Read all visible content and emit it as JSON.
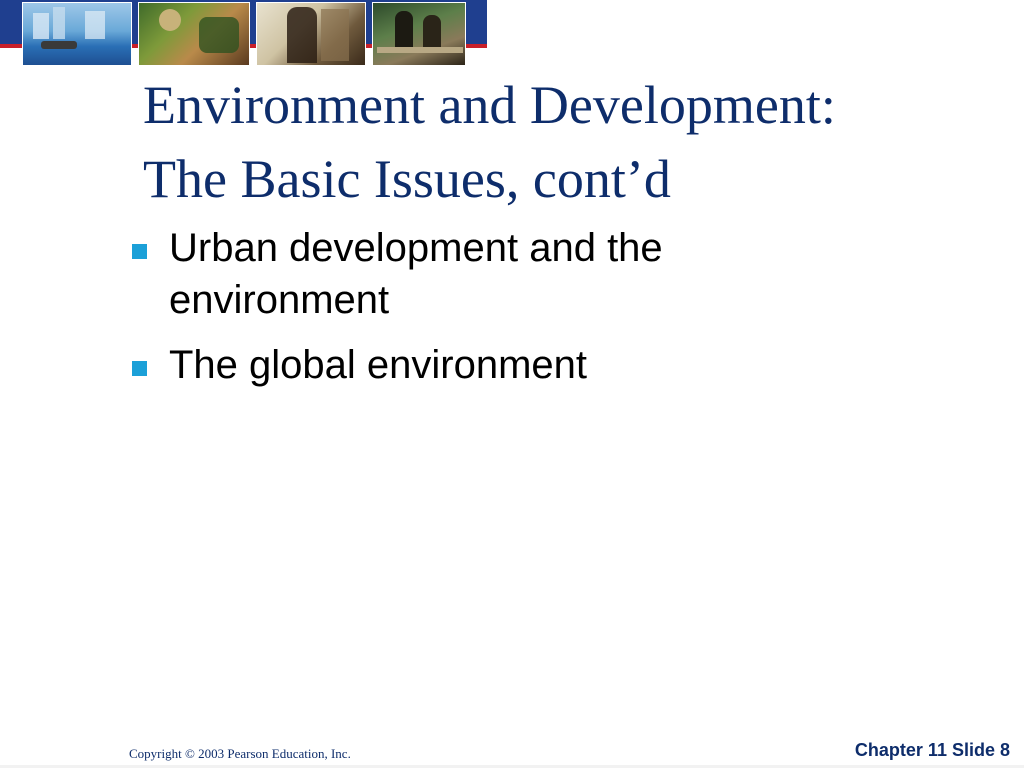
{
  "slide": {
    "title_lines": [
      "Environment and Development:",
      "The Basic Issues, cont’d"
    ],
    "bullets": [
      {
        "lines": [
          "Urban development and the",
          "environment"
        ]
      },
      {
        "lines": [
          "The global environment"
        ]
      }
    ],
    "footer": {
      "copyright": "Copyright © 2003 Pearson Education, Inc.",
      "slide_label": "Chapter 11 Slide 8"
    }
  },
  "colors": {
    "title": "#0e2d6b",
    "bullet_marker": "#1ba0d8",
    "header_band": "#1f3f8f",
    "header_accent": "#c8202a"
  },
  "icons": {
    "bullet": "square-bullet-icon"
  }
}
